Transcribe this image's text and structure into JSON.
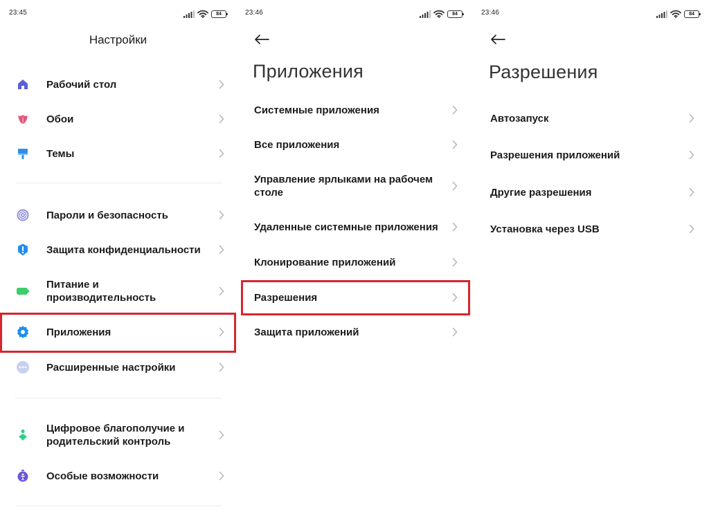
{
  "colors": {
    "highlight": "#d6252f",
    "chevron": "#b5b5b5",
    "text": "#1b1b1b"
  },
  "screens": [
    {
      "time": "23:45",
      "battery": "84",
      "title": "Настройки",
      "items": [
        {
          "label": "Рабочий стол",
          "icon": "home-icon"
        },
        {
          "label": "Обои",
          "icon": "tulip-icon"
        },
        {
          "label": "Темы",
          "icon": "brush-icon"
        },
        {
          "label": "Пароли и безопасность",
          "icon": "fingerprint-icon"
        },
        {
          "label": "Защита конфиденциальности",
          "icon": "privacy-shield-icon"
        },
        {
          "label": "Питание и производительность",
          "icon": "battery-icon"
        },
        {
          "label": "Приложения",
          "icon": "gear-icon"
        },
        {
          "label": "Расширенные настройки",
          "icon": "more-dots-icon"
        },
        {
          "label": "Цифровое благополучие и родительский контроль",
          "icon": "wellbeing-icon"
        },
        {
          "label": "Особые возможности",
          "icon": "accessibility-icon"
        }
      ]
    },
    {
      "time": "23:46",
      "battery": "84",
      "title": "Приложения",
      "items": [
        {
          "label": "Системные приложения"
        },
        {
          "label": "Все приложения"
        },
        {
          "label": "Управление ярлыками на рабочем столе"
        },
        {
          "label": "Удаленные системные приложения"
        },
        {
          "label": "Клонирование приложений"
        },
        {
          "label": "Разрешения"
        },
        {
          "label": "Защита приложений"
        }
      ]
    },
    {
      "time": "23:46",
      "battery": "84",
      "title": "Разрешения",
      "items": [
        {
          "label": "Автозапуск"
        },
        {
          "label": "Разрешения приложений"
        },
        {
          "label": "Другие разрешения"
        },
        {
          "label": "Установка через USB"
        }
      ]
    }
  ]
}
